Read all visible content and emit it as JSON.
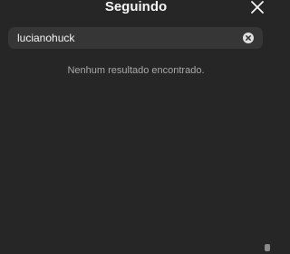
{
  "header": {
    "title": "Seguindo",
    "close_icon": "close-icon"
  },
  "search": {
    "value": "lucianohuck",
    "clear_icon": "clear-circle-icon"
  },
  "results": {
    "empty_message": "Nenhum resultado encontrado."
  },
  "colors": {
    "background": "#262626",
    "search_background": "#363636",
    "text_primary": "#f5f5f5",
    "text_secondary": "#a8a8a8"
  }
}
